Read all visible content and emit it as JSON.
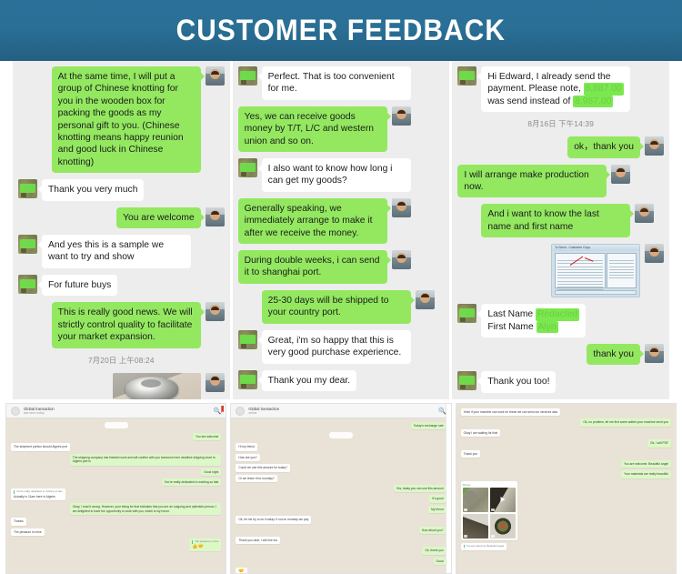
{
  "header": {
    "title": "CUSTOMER FEEDBACK",
    "background_color": "#2a6f96",
    "text_color": "#ffffff"
  },
  "theme": {
    "bubble_green": "#93e860",
    "bubble_white": "#ffffff",
    "panel_background": "#ededed",
    "redaction_color": "#7ce84f",
    "whatsapp_background": "#e9e2d7",
    "whatsapp_outgoing": "#dcf8c6"
  },
  "conversations": [
    {
      "id": "conversation-1",
      "messages": [
        {
          "side": "right",
          "type": "text",
          "avatar": "seller",
          "text": "At the same time, I will put a group of Chinese knotting for you in the wooden box for packing the goods as my personal gift to you. (Chinese knotting means happy reunion and good luck in Chinese knotting)"
        },
        {
          "side": "left",
          "type": "text",
          "avatar": "buyer",
          "text": "Thank you very much"
        },
        {
          "side": "right",
          "type": "text",
          "avatar": "seller",
          "text": "You are welcome"
        },
        {
          "side": "left",
          "type": "text",
          "avatar": "buyer",
          "text": "And yes this is a sample we want to try and show"
        },
        {
          "side": "left",
          "type": "text",
          "avatar": "buyer",
          "text": "For future buys"
        },
        {
          "side": "right",
          "type": "text",
          "avatar": "seller",
          "text": "This is really good news. We will strictly control quality to facilitate your market expansion."
        },
        {
          "side": "center",
          "type": "timestamp",
          "text": "7月20日 上午08:24"
        },
        {
          "side": "right",
          "type": "image",
          "avatar": "seller",
          "image": "photo-of-wok-in-package"
        }
      ]
    },
    {
      "id": "conversation-2",
      "messages": [
        {
          "side": "left",
          "type": "text",
          "avatar": "buyer",
          "text": "Perfect. That is too convenient for me."
        },
        {
          "side": "left",
          "type": "text",
          "avatar": "seller-right",
          "text": "Yes, we can receive goods money by T/T, L/C and western union and so on."
        },
        {
          "side": "left",
          "type": "text",
          "avatar": "buyer",
          "text": "I also want to know how long i can get my goods?"
        },
        {
          "side": "left",
          "type": "text",
          "avatar": "seller-right",
          "text": "Generally speaking, we immediately arrange to make it after we receive the money."
        },
        {
          "side": "left",
          "type": "text",
          "avatar": "seller-right",
          "text": "During double weeks, i can send it to shanghai port."
        },
        {
          "side": "left",
          "type": "text",
          "avatar": "seller-right",
          "text": "25-30 days will be shipped to your country port."
        },
        {
          "side": "left",
          "type": "text",
          "avatar": "buyer",
          "text": "Great, i'm so happy that this is very good purchase experience."
        },
        {
          "side": "left",
          "type": "text",
          "avatar": "buyer",
          "text": "Thank you my dear."
        }
      ]
    },
    {
      "id": "conversation-3",
      "messages": [
        {
          "side": "left",
          "type": "text-redacted",
          "avatar": "buyer",
          "parts": [
            {
              "kind": "text",
              "text": "Hi Edward, I already send the payment. Please note, "
            },
            {
              "kind": "redacted",
              "text": "8,887.00"
            },
            {
              "kind": "text",
              "text": " was send instead of "
            },
            {
              "kind": "redacted",
              "text": "8,987.00"
            }
          ]
        },
        {
          "side": "center",
          "type": "timestamp",
          "text": "8月16日 下午14:39"
        },
        {
          "side": "right",
          "type": "text",
          "avatar": "seller",
          "text": "ok，thank you"
        },
        {
          "side": "left-green",
          "type": "text",
          "avatar": "seller-right",
          "text": "I will arrange make production now."
        },
        {
          "side": "left-green",
          "type": "text",
          "avatar": "seller-right",
          "text": "And i want to know the last name and first name"
        },
        {
          "side": "right",
          "type": "image",
          "avatar": "seller",
          "image": "bank-transfer-customer-copy",
          "image_title": "To Send - Customer Copy"
        },
        {
          "side": "left",
          "type": "text-redacted",
          "avatar": "buyer",
          "parts": [
            {
              "kind": "text",
              "text": "Last Name "
            },
            {
              "kind": "redacted",
              "text": "Redacted"
            },
            {
              "kind": "break",
              "text": ""
            },
            {
              "kind": "text",
              "text": "First Name "
            },
            {
              "kind": "redacted",
              "text": "Alyn"
            }
          ]
        },
        {
          "side": "right",
          "type": "text",
          "avatar": "seller",
          "text": "thank you"
        },
        {
          "side": "left",
          "type": "text",
          "avatar": "buyer",
          "text": "Thank you too!"
        }
      ]
    }
  ],
  "screenshots": [
    {
      "id": "whatsapp-screenshot-1",
      "contact_name": "Global transaction",
      "contact_status": "last seen today",
      "search_icon": "search-icon",
      "messages": [
        {
          "side": "in",
          "text": "The shipment portion should Algeirs port",
          "time": "10:21"
        },
        {
          "side": "out",
          "text": "You are welcome",
          "time": "10:05"
        },
        {
          "side": "out",
          "text": "The shipping company has finished work and will confirm with you tomorrow here deadline shipping chart to Algeirs port is",
          "time": "10:27"
        },
        {
          "side": "out",
          "text": "Good night",
          "time": "10:27"
        },
        {
          "side": "out",
          "text": "You're really dedicated to working so late",
          "time": "10:28"
        },
        {
          "side": "in",
          "text": "Actually in 11am here in Algeirs",
          "time": "10:31"
        },
        {
          "side": "out",
          "text": "Okay, I read it wrong. However, your being for that indicates that you are an outgoing and optimistic person, I am delighted to have the opportunity to work with you, which is my honor.",
          "time": "10:48"
        },
        {
          "side": "in",
          "text": "Thanks",
          "time": "10:52"
        },
        {
          "side": "in",
          "text": "The pleasure is mine",
          "time": "10:52"
        },
        {
          "side": "out",
          "text": "The pleasure is mine",
          "time": "10:53"
        }
      ]
    },
    {
      "id": "whatsapp-screenshot-2",
      "contact_name": "Global transaction",
      "contact_status": "online",
      "search_icon": "search-icon",
      "messages": [
        {
          "side": "out",
          "text": "Today's exchange rate",
          "time": "09:15"
        },
        {
          "side": "in",
          "text": "Hi my friend",
          "time": "09:20"
        },
        {
          "side": "in",
          "text": "How are you?",
          "time": "09:20"
        },
        {
          "side": "in",
          "text": "Could we use this amount for today?",
          "time": "09:21"
        },
        {
          "side": "in",
          "text": "Or we leave it for monday?",
          "time": "09:21"
        },
        {
          "side": "out",
          "text": "Yes, today you can use this amount",
          "time": "09:47"
        },
        {
          "side": "out",
          "text": "It's good",
          "time": "09:48"
        },
        {
          "side": "out",
          "text": "My friend",
          "time": "09:48"
        },
        {
          "side": "in",
          "text": "Ok, let me try to do it today. If not on monday we pay",
          "time": "10:10"
        },
        {
          "side": "out",
          "text": "How about you?",
          "time": "10:15"
        },
        {
          "side": "in",
          "text": "Thank you dear, I will hire too",
          "time": "10:19"
        },
        {
          "side": "out",
          "text": "Ok, thank you",
          "time": "10:38"
        },
        {
          "side": "out",
          "text": "Good",
          "time": "10:38"
        }
      ]
    },
    {
      "id": "whatsapp-screenshot-3",
      "contact_name": "",
      "contact_status": "",
      "search_icon": "",
      "messages": [
        {
          "side": "in",
          "text": "Yeah if your machine can work for these we can send our services also",
          "time": "14:18"
        },
        {
          "side": "out",
          "text": "Ok, no problem, let me find some added your machine send you",
          "time": "14:18"
        },
        {
          "side": "in",
          "text": "Okay I am waiting for that",
          "time": "14:22"
        },
        {
          "side": "out",
          "text": "Ok, I will PDF",
          "time": "14:28"
        },
        {
          "side": "in",
          "text": "Thank you",
          "time": "14:31"
        },
        {
          "side": "out",
          "text": "You are welcome. Beautiful angel",
          "time": "14:36"
        },
        {
          "side": "out",
          "text": "Your materials are really beautiful",
          "time": "14:38"
        }
      ],
      "photo_grid": {
        "label": "Photos",
        "tiles": [
          "material-closeup-1",
          "material-closeup-2",
          "material-closeup-3",
          "mixed-materials-pan"
        ]
      },
      "quoted": "You are welcome. Beautiful angel"
    }
  ]
}
